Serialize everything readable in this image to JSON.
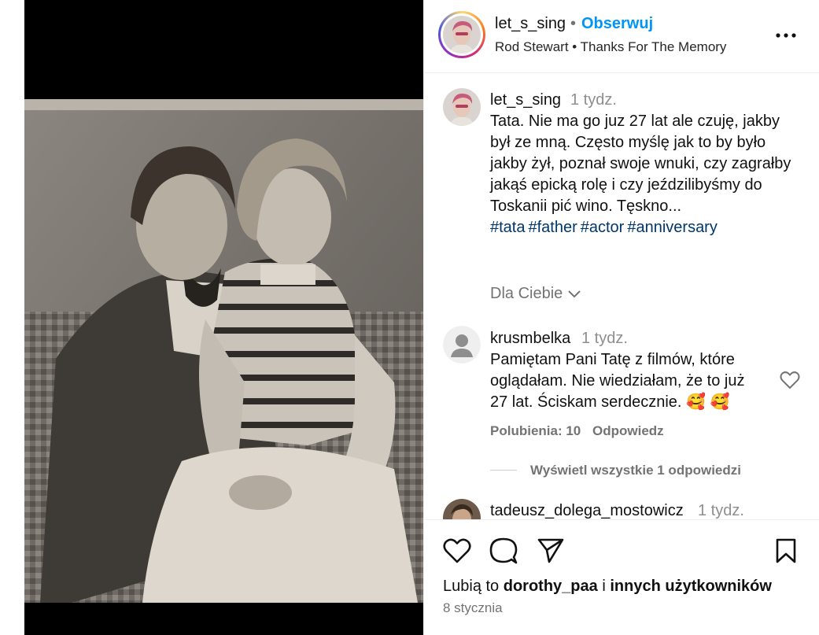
{
  "header": {
    "username": "let_s_sing",
    "separator": "•",
    "follow_label": "Obserwuj",
    "music": "Rod Stewart • Thanks For The Memory",
    "more_icon": "more-horizontal-icon"
  },
  "caption": {
    "username": "let_s_sing",
    "time": "1 tydz.",
    "text": "Tata. Nie ma go juz 27 lat ale czuję, jakby był ze mną. Często myślę jak to by było jakby żył, poznał swoje wnuki, czy zagrałby jakąś epicką rolę i czy jeździlibyśmy do Toskanii pić wino. Tęskno...",
    "hashtags": [
      "#tata",
      "#father",
      "#actor",
      "#anniversary"
    ]
  },
  "dla_ciebie": "Dla Ciebie",
  "comments": [
    {
      "username": "krusmbelka",
      "time": "1 tydz.",
      "text": "Pamiętam Pani Tatę z filmów, które oglądałam. Nie wiedziałam, że to już 27 lat. Ściskam serdecznie. 🥰 🥰",
      "likes_label": "Polubienia: 10",
      "reply_label": "Odpowiedz",
      "view_replies": "Wyświetl wszystkie 1 odpowiedzi"
    },
    {
      "username": "tadeusz_dolega_mostowicz",
      "time": "1 tydz."
    }
  ],
  "actions": {
    "like_icon": "heart-icon",
    "comment_icon": "comment-icon",
    "share_icon": "send-icon",
    "save_icon": "bookmark-icon"
  },
  "likes": {
    "prefix": "Lubią to",
    "user": "dorothy_paa",
    "middle": "i",
    "rest": "innych użytkowników"
  },
  "date": "8 stycznia",
  "colors": {
    "accent": "#0095f6",
    "hashtag": "#00376b",
    "muted": "#737373"
  }
}
